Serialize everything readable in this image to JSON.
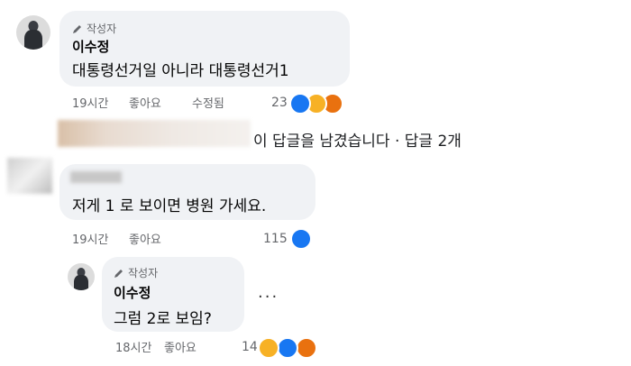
{
  "comment1": {
    "author_tag": "작성자",
    "name": "이수정",
    "text": "대통령선거일 아니라 대통령선거1",
    "time": "19시간",
    "like": "좋아요",
    "edited": "수정됨",
    "reaction_count": "23",
    "reactions": [
      "like-icon",
      "haha-icon",
      "angry-icon"
    ]
  },
  "replies_link": {
    "text": "이 답글을 남겼습니다 · 답글 2개"
  },
  "comment2": {
    "text": "저게 1 로 보이면 병원 가세요.",
    "time": "19시간",
    "like": "좋아요",
    "reaction_count": "115",
    "reactions": [
      "like-icon"
    ]
  },
  "reply1": {
    "author_tag": "작성자",
    "name": "이수정",
    "text": "그럼 2로 보임?",
    "time": "18시간",
    "like": "좋아요",
    "reaction_count": "14",
    "reactions": [
      "haha-icon",
      "like-icon",
      "angry-icon"
    ],
    "more": "..."
  },
  "colors": {
    "bubble": "#f0f2f5",
    "secondary_text": "#65676b",
    "like_blue": "#1877f2",
    "haha_yellow": "#f7b125",
    "angry_orange": "#e9710f"
  }
}
